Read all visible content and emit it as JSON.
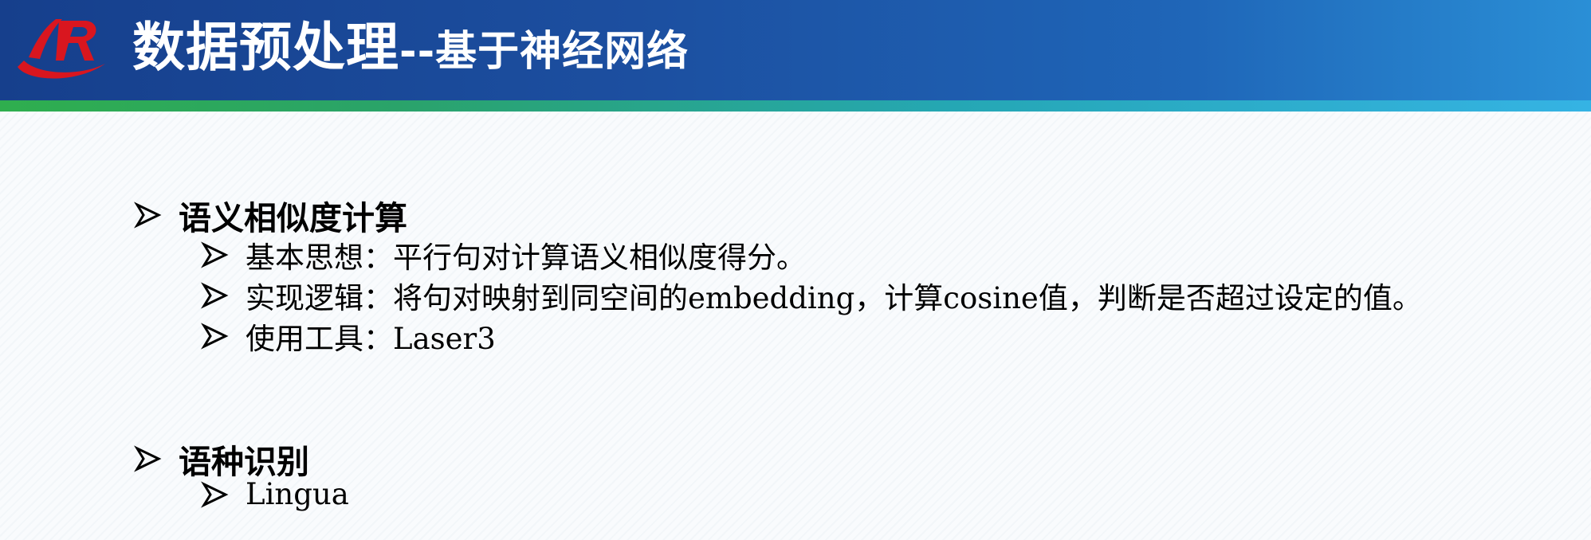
{
  "header": {
    "title_main": "数据预处理",
    "title_sub": "--基于神经网络",
    "logo_icon": "ir-logo-icon",
    "colors": {
      "bar_start": "#163f8c",
      "bar_end": "#2a8fd6",
      "stripe_start": "#2fae4e",
      "stripe_end": "#35b3e4",
      "logo_red": "#d9161f"
    }
  },
  "sections": [
    {
      "heading": "语义相似度计算",
      "bullet_icon": "arrow-bullet-icon",
      "items": [
        "基本思想：平行句对计算语义相似度得分。",
        "实现逻辑：将句对映射到同空间的embedding，计算cosine值，判断是否超过设定的值。",
        "使用工具：Laser3"
      ]
    },
    {
      "heading": "语种识别",
      "bullet_icon": "arrow-bullet-icon",
      "items": [
        "Lingua"
      ]
    }
  ]
}
